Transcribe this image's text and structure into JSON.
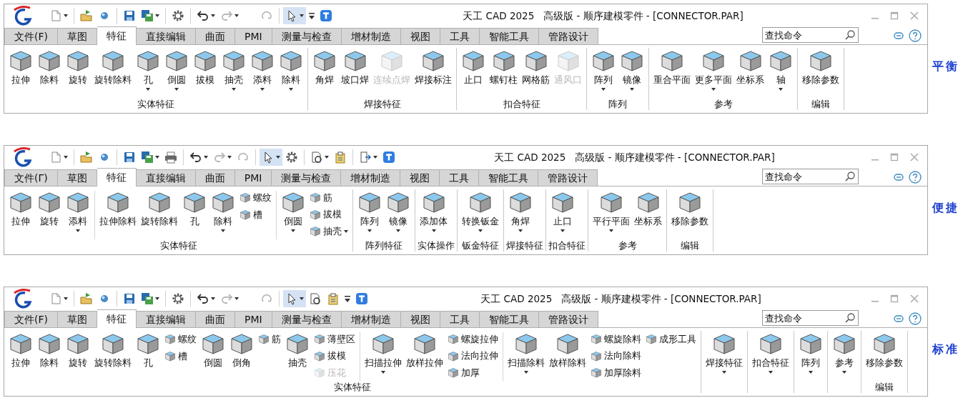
{
  "panels": [
    {
      "window": {
        "title": "天工 CAD 2025   高级版 - 顺序建模零件 - [CONNECTOR.PAR]"
      },
      "quick_access": [
        {
          "kind": "new",
          "dropdown": true,
          "disabled": false,
          "selected": false
        },
        {
          "kind": "separator"
        },
        {
          "kind": "open",
          "dropdown": false,
          "disabled": false,
          "selected": false
        },
        {
          "kind": "sphere",
          "dropdown": false,
          "disabled": false,
          "selected": false
        },
        {
          "kind": "separator"
        },
        {
          "kind": "save",
          "dropdown": false,
          "disabled": false,
          "selected": false
        },
        {
          "kind": "saveas",
          "dropdown": true,
          "disabled": false,
          "selected": false
        },
        {
          "kind": "separator"
        },
        {
          "kind": "gear",
          "dropdown": false,
          "disabled": false,
          "selected": false
        },
        {
          "kind": "separator"
        },
        {
          "kind": "undo",
          "dropdown": true,
          "disabled": false,
          "selected": false
        },
        {
          "kind": "redo",
          "dropdown": true,
          "disabled": true,
          "selected": false
        },
        {
          "kind": "gap"
        },
        {
          "kind": "repeat",
          "dropdown": false,
          "disabled": true,
          "selected": false
        },
        {
          "kind": "separator"
        },
        {
          "kind": "select",
          "dropdown": true,
          "disabled": false,
          "selected": true
        },
        {
          "kind": "customize",
          "dropdown": false,
          "disabled": false,
          "selected": false
        },
        {
          "kind": "app",
          "dropdown": false,
          "disabled": false,
          "selected": false
        }
      ],
      "tabs": [
        {
          "label": "文件(F)",
          "selected": false
        },
        {
          "label": "草图",
          "selected": false
        },
        {
          "label": "特征",
          "selected": true
        },
        {
          "label": "直接编辑",
          "selected": false
        },
        {
          "label": "曲面",
          "selected": false
        },
        {
          "label": "PMI",
          "selected": false
        },
        {
          "label": "测量与检查",
          "selected": false
        },
        {
          "label": "增材制造",
          "selected": false
        },
        {
          "label": "视图",
          "selected": false
        },
        {
          "label": "工具",
          "selected": false
        },
        {
          "label": "智能工具",
          "selected": false
        },
        {
          "label": "管路设计",
          "selected": false
        }
      ],
      "search": {
        "placeholder": "查找命令"
      },
      "ribbon": [
        {
          "label": "实体特征",
          "items": [
            {
              "kind": "large",
              "label": "拉伸",
              "dropdown": false,
              "disabled": false
            },
            {
              "kind": "large",
              "label": "除料",
              "dropdown": false,
              "disabled": false
            },
            {
              "kind": "large",
              "label": "旋转",
              "dropdown": false,
              "disabled": false
            },
            {
              "kind": "large",
              "label": "旋转除料",
              "dropdown": false,
              "disabled": false
            },
            {
              "kind": "large",
              "label": "孔",
              "dropdown": true,
              "disabled": false
            },
            {
              "kind": "large",
              "label": "倒圆",
              "dropdown": true,
              "disabled": false
            },
            {
              "kind": "large",
              "label": "拔模",
              "dropdown": false,
              "disabled": false
            },
            {
              "kind": "large",
              "label": "抽壳",
              "dropdown": true,
              "disabled": false
            },
            {
              "kind": "large",
              "label": "添料",
              "dropdown": true,
              "disabled": false
            },
            {
              "kind": "large",
              "label": "除料",
              "dropdown": true,
              "disabled": false
            }
          ]
        },
        {
          "label": "焊接特征",
          "items": [
            {
              "kind": "large",
              "label": "角焊",
              "dropdown": false,
              "disabled": false
            },
            {
              "kind": "large",
              "label": "坡口焊",
              "dropdown": false,
              "disabled": false
            },
            {
              "kind": "large",
              "label": "连续点焊",
              "dropdown": false,
              "disabled": true
            },
            {
              "kind": "large",
              "label": "焊接标注",
              "dropdown": false,
              "disabled": false
            }
          ]
        },
        {
          "label": "扣合特征",
          "items": [
            {
              "kind": "large",
              "label": "止口",
              "dropdown": false,
              "disabled": false
            },
            {
              "kind": "large",
              "label": "螺钉柱",
              "dropdown": false,
              "disabled": false
            },
            {
              "kind": "large",
              "label": "网格筋",
              "dropdown": false,
              "disabled": false
            },
            {
              "kind": "large",
              "label": "通风口",
              "dropdown": false,
              "disabled": true
            }
          ]
        },
        {
          "label": "阵列",
          "items": [
            {
              "kind": "large",
              "label": "阵列",
              "dropdown": true,
              "disabled": false
            },
            {
              "kind": "large",
              "label": "镜像",
              "dropdown": true,
              "disabled": false
            }
          ]
        },
        {
          "label": "参考",
          "items": [
            {
              "kind": "large",
              "label": "重合平面",
              "dropdown": false,
              "disabled": false
            },
            {
              "kind": "large",
              "label": "更多平面",
              "dropdown": true,
              "disabled": false
            },
            {
              "kind": "large",
              "label": "坐标系",
              "dropdown": false,
              "disabled": false
            },
            {
              "kind": "large",
              "label": "轴",
              "dropdown": true,
              "disabled": false
            }
          ]
        },
        {
          "label": "编辑",
          "items": [
            {
              "kind": "large",
              "label": "移除参数",
              "dropdown": false,
              "disabled": false
            }
          ]
        }
      ],
      "side_label": "平衡"
    },
    {
      "window": {
        "title": "天工 CAD 2025   高级版 - 顺序建模零件 - [CONNECTOR.PAR]"
      },
      "quick_access": [
        {
          "kind": "new",
          "dropdown": true,
          "disabled": false,
          "selected": false
        },
        {
          "kind": "separator"
        },
        {
          "kind": "open",
          "dropdown": false,
          "disabled": false,
          "selected": false
        },
        {
          "kind": "sphere",
          "dropdown": false,
          "disabled": false,
          "selected": false
        },
        {
          "kind": "separator"
        },
        {
          "kind": "save",
          "dropdown": false,
          "disabled": false,
          "selected": false
        },
        {
          "kind": "saveas",
          "dropdown": true,
          "disabled": false,
          "selected": false
        },
        {
          "kind": "print",
          "dropdown": false,
          "disabled": false,
          "selected": false
        },
        {
          "kind": "separator"
        },
        {
          "kind": "undo",
          "dropdown": true,
          "disabled": false,
          "selected": false
        },
        {
          "kind": "redo",
          "dropdown": true,
          "disabled": true,
          "selected": false
        },
        {
          "kind": "repeat",
          "dropdown": false,
          "disabled": true,
          "selected": false
        },
        {
          "kind": "separator"
        },
        {
          "kind": "select",
          "dropdown": true,
          "disabled": false,
          "selected": true
        },
        {
          "kind": "gear",
          "dropdown": false,
          "disabled": false,
          "selected": false
        },
        {
          "kind": "separator"
        },
        {
          "kind": "doc",
          "dropdown": true,
          "disabled": false,
          "selected": false
        },
        {
          "kind": "export",
          "dropdown": false,
          "disabled": false,
          "selected": false
        },
        {
          "kind": "separator"
        },
        {
          "kind": "exit",
          "dropdown": true,
          "disabled": false,
          "selected": false
        },
        {
          "kind": "app",
          "dropdown": false,
          "disabled": false,
          "selected": false
        }
      ],
      "tabs": [
        {
          "label": "文件(Γ)",
          "selected": false
        },
        {
          "label": "草图",
          "selected": false
        },
        {
          "label": "特征",
          "selected": true
        },
        {
          "label": "直接编辑",
          "selected": false
        },
        {
          "label": "曲面",
          "selected": false
        },
        {
          "label": "PMI",
          "selected": false
        },
        {
          "label": "测量与检查",
          "selected": false
        },
        {
          "label": "增材制造",
          "selected": false
        },
        {
          "label": "视图",
          "selected": false
        },
        {
          "label": "工具",
          "selected": false
        },
        {
          "label": "智能工具",
          "selected": false
        },
        {
          "label": "管路设计",
          "selected": false
        }
      ],
      "search": {
        "placeholder": "查找命令"
      },
      "ribbon": [
        {
          "label": "实体特征",
          "items": [
            {
              "kind": "large",
              "label": "拉伸",
              "dropdown": false,
              "disabled": false
            },
            {
              "kind": "large",
              "label": "旋转",
              "dropdown": false,
              "disabled": false
            },
            {
              "kind": "large",
              "label": "添料",
              "dropdown": true,
              "disabled": false
            },
            {
              "kind": "separator"
            },
            {
              "kind": "large",
              "label": "拉伸除料",
              "dropdown": false,
              "disabled": false
            },
            {
              "kind": "large",
              "label": "旋转除料",
              "dropdown": false,
              "disabled": false
            },
            {
              "kind": "large",
              "label": "孔",
              "dropdown": false,
              "disabled": false
            },
            {
              "kind": "large",
              "label": "除料",
              "dropdown": true,
              "disabled": false
            },
            {
              "kind": "stack",
              "items": [
                {
                  "label": "螺纹",
                  "dropdown": false,
                  "disabled": false
                },
                {
                  "label": "槽",
                  "dropdown": false,
                  "disabled": false
                }
              ]
            },
            {
              "kind": "separator"
            },
            {
              "kind": "large",
              "label": "倒圆",
              "dropdown": true,
              "disabled": false
            },
            {
              "kind": "stack",
              "items": [
                {
                  "label": "筋",
                  "dropdown": false,
                  "disabled": false
                },
                {
                  "label": "拔模",
                  "dropdown": false,
                  "disabled": false
                },
                {
                  "label": "抽壳",
                  "dropdown": true,
                  "disabled": false
                }
              ]
            }
          ]
        },
        {
          "label": "阵列特征",
          "items": [
            {
              "kind": "large",
              "label": "阵列",
              "dropdown": true,
              "disabled": false
            },
            {
              "kind": "large",
              "label": "镜像",
              "dropdown": true,
              "disabled": false
            }
          ]
        },
        {
          "label": "实体操作",
          "items": [
            {
              "kind": "large",
              "label": "添加体",
              "dropdown": true,
              "disabled": false
            }
          ]
        },
        {
          "label": "钣金特征",
          "items": [
            {
              "kind": "large",
              "label": "转换钣金",
              "dropdown": true,
              "disabled": false
            }
          ]
        },
        {
          "label": "焊接特征",
          "items": [
            {
              "kind": "large",
              "label": "角焊",
              "dropdown": true,
              "disabled": false
            }
          ]
        },
        {
          "label": "扣合特征",
          "items": [
            {
              "kind": "large",
              "label": "止口",
              "dropdown": true,
              "disabled": false
            }
          ]
        },
        {
          "label": "参考",
          "items": [
            {
              "kind": "large",
              "label": "平行平面",
              "dropdown": true,
              "disabled": false
            },
            {
              "kind": "large",
              "label": "坐标系",
              "dropdown": false,
              "disabled": false
            }
          ]
        },
        {
          "label": "编辑",
          "items": [
            {
              "kind": "large",
              "label": "移除参数",
              "dropdown": false,
              "disabled": false
            }
          ]
        }
      ],
      "side_label": "便捷"
    },
    {
      "window": {
        "title": "天工 CAD 2025   高级版 - 顺序建模零件 - [CONNECTOR.PAR]"
      },
      "quick_access": [
        {
          "kind": "new",
          "dropdown": true,
          "disabled": false,
          "selected": false
        },
        {
          "kind": "separator"
        },
        {
          "kind": "open",
          "dropdown": false,
          "disabled": false,
          "selected": false
        },
        {
          "kind": "sphere",
          "dropdown": false,
          "disabled": false,
          "selected": false
        },
        {
          "kind": "separator"
        },
        {
          "kind": "save",
          "dropdown": false,
          "disabled": false,
          "selected": false
        },
        {
          "kind": "saveas",
          "dropdown": true,
          "disabled": false,
          "selected": false
        },
        {
          "kind": "separator"
        },
        {
          "kind": "gear",
          "dropdown": false,
          "disabled": false,
          "selected": false
        },
        {
          "kind": "separator"
        },
        {
          "kind": "undo",
          "dropdown": true,
          "disabled": false,
          "selected": false
        },
        {
          "kind": "redo",
          "dropdown": true,
          "disabled": true,
          "selected": false
        },
        {
          "kind": "gap"
        },
        {
          "kind": "repeat",
          "dropdown": false,
          "disabled": true,
          "selected": false
        },
        {
          "kind": "separator"
        },
        {
          "kind": "select",
          "dropdown": true,
          "disabled": false,
          "selected": true
        },
        {
          "kind": "doc",
          "dropdown": false,
          "disabled": false,
          "selected": false
        },
        {
          "kind": "export",
          "dropdown": false,
          "disabled": false,
          "selected": false
        },
        {
          "kind": "customize",
          "dropdown": false,
          "disabled": false,
          "selected": false
        },
        {
          "kind": "app",
          "dropdown": false,
          "disabled": false,
          "selected": false
        }
      ],
      "tabs": [
        {
          "label": "文件(F)",
          "selected": false
        },
        {
          "label": "草图",
          "selected": false
        },
        {
          "label": "特征",
          "selected": true
        },
        {
          "label": "直接编辑",
          "selected": false
        },
        {
          "label": "曲面",
          "selected": false
        },
        {
          "label": "PMI",
          "selected": false
        },
        {
          "label": "测量与检查",
          "selected": false
        },
        {
          "label": "增材制造",
          "selected": false
        },
        {
          "label": "视图",
          "selected": false
        },
        {
          "label": "工具",
          "selected": false
        },
        {
          "label": "智能工具",
          "selected": false
        },
        {
          "label": "管路设计",
          "selected": false
        }
      ],
      "search": {
        "placeholder": "查找命令"
      },
      "ribbon": [
        {
          "label": "实体特征",
          "items": [
            {
              "kind": "large",
              "label": "拉伸",
              "dropdown": false,
              "disabled": false
            },
            {
              "kind": "large",
              "label": "除料",
              "dropdown": false,
              "disabled": false
            },
            {
              "kind": "large",
              "label": "旋转",
              "dropdown": false,
              "disabled": false
            },
            {
              "kind": "large",
              "label": "旋转除料",
              "dropdown": false,
              "disabled": false
            },
            {
              "kind": "large",
              "label": "孔",
              "dropdown": false,
              "disabled": false
            },
            {
              "kind": "stack",
              "items": [
                {
                  "label": "螺纹",
                  "dropdown": false,
                  "disabled": false
                },
                {
                  "label": "槽",
                  "dropdown": false,
                  "disabled": false
                }
              ]
            },
            {
              "kind": "large",
              "label": "倒圆",
              "dropdown": false,
              "disabled": false
            },
            {
              "kind": "large",
              "label": "倒角",
              "dropdown": false,
              "disabled": false
            },
            {
              "kind": "stack",
              "items": [
                {
                  "label": "筋",
                  "dropdown": false,
                  "disabled": false
                }
              ]
            },
            {
              "kind": "large",
              "label": "抽壳",
              "dropdown": false,
              "disabled": false
            },
            {
              "kind": "stack",
              "items": [
                {
                  "label": "薄壁区",
                  "dropdown": false,
                  "disabled": false
                },
                {
                  "label": "拔模",
                  "dropdown": false,
                  "disabled": false
                },
                {
                  "label": "压花",
                  "dropdown": false,
                  "disabled": true
                }
              ]
            },
            {
              "kind": "separator"
            },
            {
              "kind": "large",
              "label": "扫描拉伸",
              "dropdown": true,
              "disabled": false
            },
            {
              "kind": "large",
              "label": "放样拉伸",
              "dropdown": false,
              "disabled": false
            },
            {
              "kind": "stack",
              "items": [
                {
                  "label": "螺旋拉伸",
                  "dropdown": false,
                  "disabled": false
                },
                {
                  "label": "法向拉伸",
                  "dropdown": false,
                  "disabled": false
                },
                {
                  "label": "加厚",
                  "dropdown": false,
                  "disabled": false
                }
              ]
            },
            {
              "kind": "separator"
            },
            {
              "kind": "large",
              "label": "扫描除料",
              "dropdown": true,
              "disabled": false
            },
            {
              "kind": "large",
              "label": "放样除料",
              "dropdown": false,
              "disabled": false
            },
            {
              "kind": "stack",
              "items": [
                {
                  "label": "螺旋除料",
                  "dropdown": false,
                  "disabled": false
                },
                {
                  "label": "法向除料",
                  "dropdown": false,
                  "disabled": false
                },
                {
                  "label": "加厚除料",
                  "dropdown": false,
                  "disabled": false
                }
              ]
            },
            {
              "kind": "stack",
              "items": [
                {
                  "label": "成形工具",
                  "dropdown": false,
                  "disabled": false
                }
              ]
            }
          ]
        },
        {
          "items": [
            {
              "kind": "large",
              "label": "焊接特征",
              "dropdown": true,
              "disabled": false
            }
          ]
        },
        {
          "items": [
            {
              "kind": "large",
              "label": "扣合特征",
              "dropdown": true,
              "disabled": false
            }
          ]
        },
        {
          "items": [
            {
              "kind": "large",
              "label": "阵列",
              "dropdown": true,
              "disabled": false
            }
          ]
        },
        {
          "items": [
            {
              "kind": "large",
              "label": "参考",
              "dropdown": true,
              "disabled": false
            }
          ]
        },
        {
          "label": "编辑",
          "items": [
            {
              "kind": "large",
              "label": "移除参数",
              "dropdown": false,
              "disabled": false
            }
          ]
        }
      ],
      "side_label": "标准"
    }
  ]
}
